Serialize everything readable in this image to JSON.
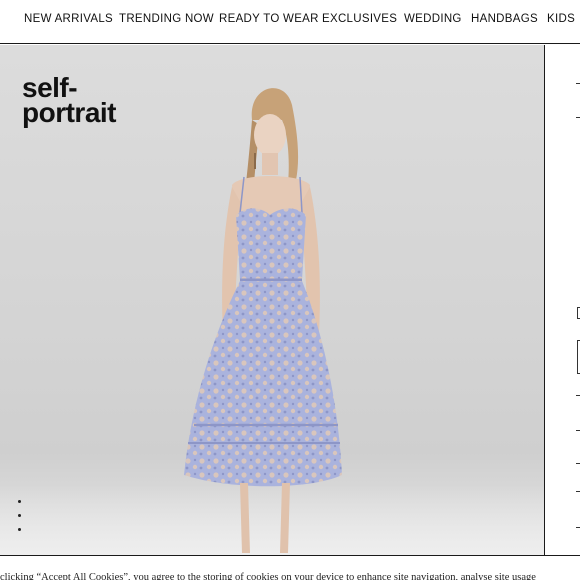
{
  "nav": {
    "items": [
      {
        "label": "NEW ARRIVALS"
      },
      {
        "label": "TRENDING NOW"
      },
      {
        "label": "READY TO WEAR"
      },
      {
        "label": "EXCLUSIVES"
      },
      {
        "label": "WEDDING"
      },
      {
        "label": "HANDBAGS"
      },
      {
        "label": "KIDS"
      }
    ]
  },
  "brand": {
    "line1": "self-",
    "line2": "portrait"
  },
  "hero": {
    "dress_color": "#aab3dd",
    "background_color": "#d6d6d6"
  },
  "cookie_banner": {
    "text": "clicking “Accept All Cookies”, you agree to the storing of cookies on your device to enhance site navigation, analyse site usage"
  }
}
